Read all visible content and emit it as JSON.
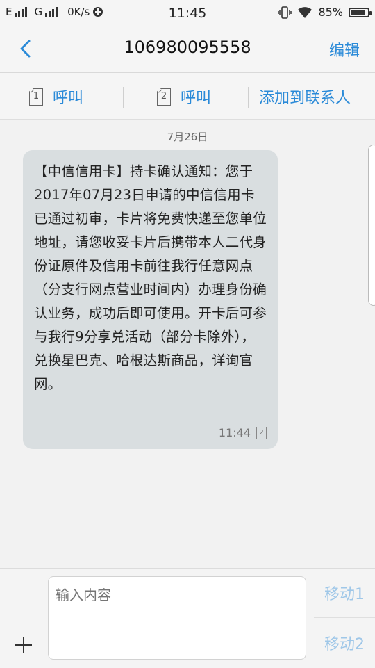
{
  "status_bar": {
    "signal1_label": "E",
    "signal2_label": "G",
    "speed": "0K/s",
    "time": "11:45",
    "battery": "85%",
    "battery_level": 0.85
  },
  "header": {
    "title": "106980095558",
    "edit_label": "编辑"
  },
  "actions": {
    "call_sim1_label": "呼叫",
    "sim1_number": "1",
    "call_sim2_label": "呼叫",
    "sim2_number": "2",
    "add_contact_label": "添加到联系人"
  },
  "conversation": {
    "date": "7月26日",
    "message": {
      "text": "【中信信用卡】持卡确认通知：您于2017年07月23日申请的中信信用卡已通过初审，卡片将免费快递至您单位地址，请您收妥卡片后携带本人二代身份证原件及信用卡前往我行任意网点（分支行网点营业时间内）办理身份确认业务，成功后即可使用。开卡后可参与我行9分享兑活动（部分卡除外），兑换星巴克、哈根达斯商品，详询官网。",
      "time": "11:44",
      "sim": "2"
    }
  },
  "composer": {
    "placeholder": "输入内容",
    "send_sim1_label": "移动1",
    "send_sim2_label": "移动2"
  },
  "colors": {
    "accent": "#2a8ad8",
    "bubble": "#d9dee0",
    "send_disabled": "#9fc7e8"
  },
  "icons": [
    "wifi-icon",
    "vibrate-icon",
    "battery-icon",
    "back-icon",
    "sim-icon",
    "plus-icon"
  ]
}
